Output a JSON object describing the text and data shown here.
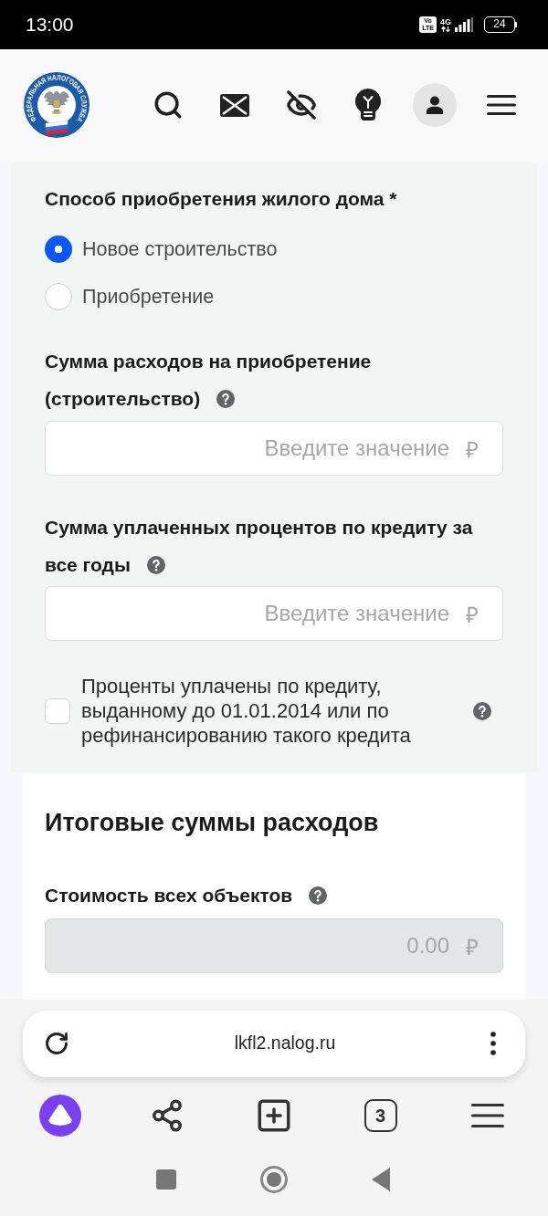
{
  "status_bar": {
    "time": "13:00",
    "volte": "Vo LTE",
    "network": "4G",
    "battery": "24"
  },
  "header": {
    "logo_text": "ФЕДЕРАЛЬНАЯ НАЛОГОВАЯ СЛУЖБА"
  },
  "form": {
    "purchase_method": {
      "label": "Способ приобретения жилого дома *",
      "options": [
        {
          "label": "Новое строительство",
          "selected": true
        },
        {
          "label": "Приобретение",
          "selected": false
        }
      ]
    },
    "fields": [
      {
        "label_lines": [
          "Сумма расходов на приобретение",
          "(строительство)"
        ],
        "placeholder": "Введите значение",
        "currency": "₽",
        "disabled": false
      },
      {
        "label_lines": [
          "Сумма уплаченных процентов по кредиту за",
          "все годы"
        ],
        "placeholder": "Введите значение",
        "currency": "₽",
        "disabled": false
      }
    ],
    "checkbox": {
      "label": "Проценты уплачены по кредиту, выданному до 01.01.2014 или по рефинансированию такого кредита",
      "checked": false
    }
  },
  "totals": {
    "title": "Итоговые суммы расходов",
    "fields": [
      {
        "label_lines": [
          "Стоимость всех объектов"
        ],
        "value": "0.00",
        "currency": "₽",
        "disabled": true
      }
    ]
  },
  "browser": {
    "url": "lkfl2.nalog.ru",
    "tab_count": "3"
  }
}
